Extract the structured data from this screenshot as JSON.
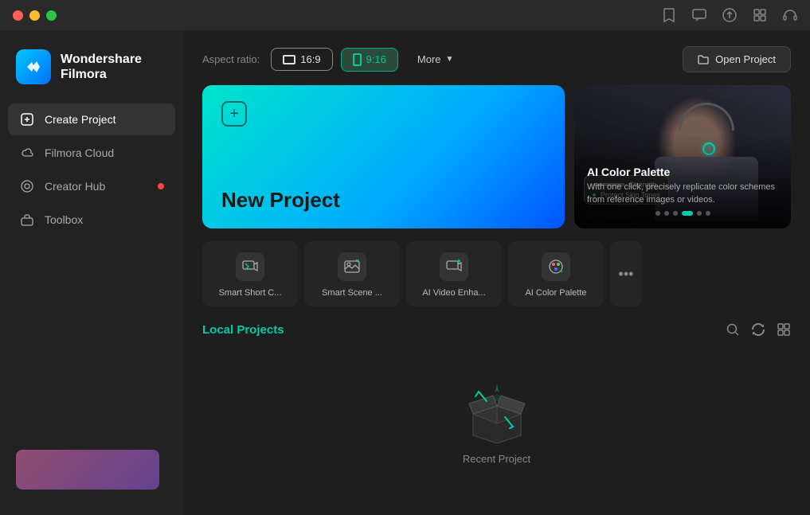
{
  "titlebar": {
    "app_name": "Wondershare Filmora"
  },
  "sidebar": {
    "logo_title": "Wondershare",
    "logo_subtitle": "Filmora",
    "nav_items": [
      {
        "id": "create-project",
        "label": "Create Project",
        "active": true,
        "badge": false
      },
      {
        "id": "filmora-cloud",
        "label": "Filmora Cloud",
        "active": false,
        "badge": false
      },
      {
        "id": "creator-hub",
        "label": "Creator Hub",
        "active": false,
        "badge": true
      },
      {
        "id": "toolbox",
        "label": "Toolbox",
        "active": false,
        "badge": false
      }
    ]
  },
  "toolbar": {
    "aspect_ratio_label": "Aspect ratio:",
    "btn_16_9": "16:9",
    "btn_9_16": "9:16",
    "btn_more": "More",
    "btn_open_project": "Open Project"
  },
  "new_project": {
    "label": "New Project"
  },
  "ai_feature": {
    "title": "AI Color Palette",
    "description": "With one click, precisely replicate color schemes from reference images or videos.",
    "panel_line1": "Strength",
    "panel_line2": "Protect Skin Tones"
  },
  "carousel": {
    "total_dots": 6,
    "active_dot": 3
  },
  "tools": [
    {
      "id": "smart-short-clip",
      "label": "Smart Short C...",
      "icon": "🎬"
    },
    {
      "id": "smart-scene",
      "label": "Smart Scene ...",
      "icon": "🎭"
    },
    {
      "id": "ai-video-enhance",
      "label": "AI Video Enha...",
      "icon": "✨"
    },
    {
      "id": "ai-color-palette",
      "label": "AI Color Palette",
      "icon": "🎨"
    }
  ],
  "tools_more_label": "•••",
  "local_projects": {
    "title": "Local Projects",
    "empty_label": "Recent Project"
  },
  "section_actions": {
    "search_icon": "search",
    "refresh_icon": "refresh",
    "grid_icon": "grid"
  }
}
